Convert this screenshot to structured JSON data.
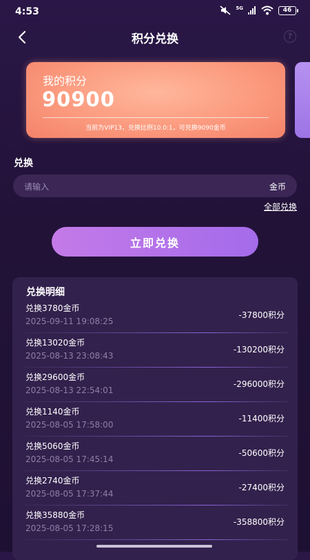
{
  "status": {
    "time": "4:53",
    "network": "5G",
    "battery": "46"
  },
  "header": {
    "title": "积分兑换",
    "back_icon": "chevron-left-icon",
    "help_icon": "question-circle-icon"
  },
  "points_card": {
    "label": "我的积分",
    "value": "90900",
    "info": "当前为VIP13，兑换比例10.0:1，可兑换9090金币",
    "colors": {
      "card": "#fb9a7e",
      "next_card": "#a47ce8"
    }
  },
  "exchange": {
    "section_label": "兑换",
    "input_placeholder": "请输入",
    "input_value": "",
    "unit": "金币",
    "all_link": "全部兑换",
    "button_label": "立即兑换",
    "button_color": "#b272e9"
  },
  "history": {
    "title": "兑换明细",
    "items": [
      {
        "title": "兑换3780金币",
        "time": "2025-09-11 19:08:25",
        "amount": "-37800积分"
      },
      {
        "title": "兑换13020金币",
        "time": "2025-08-13 23:08:43",
        "amount": "-130200积分"
      },
      {
        "title": "兑换29600金币",
        "time": "2025-08-13 22:54:01",
        "amount": "-296000积分"
      },
      {
        "title": "兑换1140金币",
        "time": "2025-08-05 17:58:00",
        "amount": "-11400积分"
      },
      {
        "title": "兑换5060金币",
        "time": "2025-08-05 17:45:14",
        "amount": "-50600积分"
      },
      {
        "title": "兑换2740金币",
        "time": "2025-08-05 17:37:44",
        "amount": "-27400积分"
      },
      {
        "title": "兑换35880金币",
        "time": "2025-08-05 17:28:15",
        "amount": "-358800积分"
      }
    ]
  }
}
